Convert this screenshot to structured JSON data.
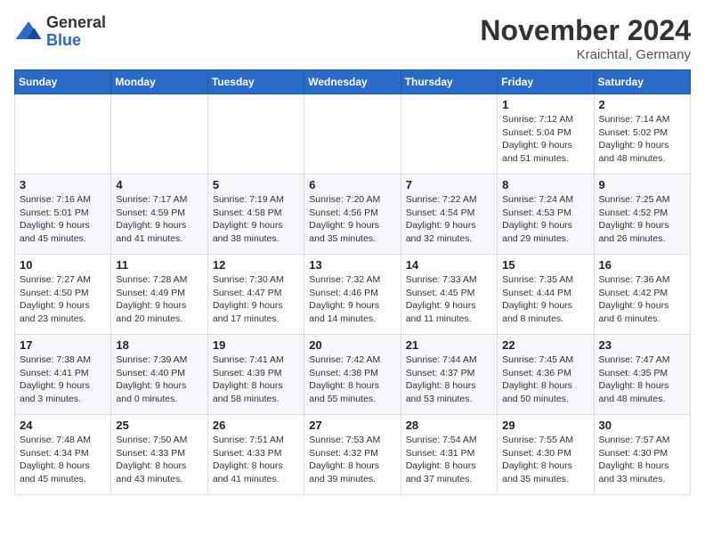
{
  "logo": {
    "general": "General",
    "blue": "Blue"
  },
  "title": "November 2024",
  "location": "Kraichtal, Germany",
  "days_of_week": [
    "Sunday",
    "Monday",
    "Tuesday",
    "Wednesday",
    "Thursday",
    "Friday",
    "Saturday"
  ],
  "weeks": [
    [
      {
        "day": "",
        "info": ""
      },
      {
        "day": "",
        "info": ""
      },
      {
        "day": "",
        "info": ""
      },
      {
        "day": "",
        "info": ""
      },
      {
        "day": "",
        "info": ""
      },
      {
        "day": "1",
        "info": "Sunrise: 7:12 AM\nSunset: 5:04 PM\nDaylight: 9 hours and 51 minutes."
      },
      {
        "day": "2",
        "info": "Sunrise: 7:14 AM\nSunset: 5:02 PM\nDaylight: 9 hours and 48 minutes."
      }
    ],
    [
      {
        "day": "3",
        "info": "Sunrise: 7:16 AM\nSunset: 5:01 PM\nDaylight: 9 hours and 45 minutes."
      },
      {
        "day": "4",
        "info": "Sunrise: 7:17 AM\nSunset: 4:59 PM\nDaylight: 9 hours and 41 minutes."
      },
      {
        "day": "5",
        "info": "Sunrise: 7:19 AM\nSunset: 4:58 PM\nDaylight: 9 hours and 38 minutes."
      },
      {
        "day": "6",
        "info": "Sunrise: 7:20 AM\nSunset: 4:56 PM\nDaylight: 9 hours and 35 minutes."
      },
      {
        "day": "7",
        "info": "Sunrise: 7:22 AM\nSunset: 4:54 PM\nDaylight: 9 hours and 32 minutes."
      },
      {
        "day": "8",
        "info": "Sunrise: 7:24 AM\nSunset: 4:53 PM\nDaylight: 9 hours and 29 minutes."
      },
      {
        "day": "9",
        "info": "Sunrise: 7:25 AM\nSunset: 4:52 PM\nDaylight: 9 hours and 26 minutes."
      }
    ],
    [
      {
        "day": "10",
        "info": "Sunrise: 7:27 AM\nSunset: 4:50 PM\nDaylight: 9 hours and 23 minutes."
      },
      {
        "day": "11",
        "info": "Sunrise: 7:28 AM\nSunset: 4:49 PM\nDaylight: 9 hours and 20 minutes."
      },
      {
        "day": "12",
        "info": "Sunrise: 7:30 AM\nSunset: 4:47 PM\nDaylight: 9 hours and 17 minutes."
      },
      {
        "day": "13",
        "info": "Sunrise: 7:32 AM\nSunset: 4:46 PM\nDaylight: 9 hours and 14 minutes."
      },
      {
        "day": "14",
        "info": "Sunrise: 7:33 AM\nSunset: 4:45 PM\nDaylight: 9 hours and 11 minutes."
      },
      {
        "day": "15",
        "info": "Sunrise: 7:35 AM\nSunset: 4:44 PM\nDaylight: 9 hours and 8 minutes."
      },
      {
        "day": "16",
        "info": "Sunrise: 7:36 AM\nSunset: 4:42 PM\nDaylight: 9 hours and 6 minutes."
      }
    ],
    [
      {
        "day": "17",
        "info": "Sunrise: 7:38 AM\nSunset: 4:41 PM\nDaylight: 9 hours and 3 minutes."
      },
      {
        "day": "18",
        "info": "Sunrise: 7:39 AM\nSunset: 4:40 PM\nDaylight: 9 hours and 0 minutes."
      },
      {
        "day": "19",
        "info": "Sunrise: 7:41 AM\nSunset: 4:39 PM\nDaylight: 8 hours and 58 minutes."
      },
      {
        "day": "20",
        "info": "Sunrise: 7:42 AM\nSunset: 4:38 PM\nDaylight: 8 hours and 55 minutes."
      },
      {
        "day": "21",
        "info": "Sunrise: 7:44 AM\nSunset: 4:37 PM\nDaylight: 8 hours and 53 minutes."
      },
      {
        "day": "22",
        "info": "Sunrise: 7:45 AM\nSunset: 4:36 PM\nDaylight: 8 hours and 50 minutes."
      },
      {
        "day": "23",
        "info": "Sunrise: 7:47 AM\nSunset: 4:35 PM\nDaylight: 8 hours and 48 minutes."
      }
    ],
    [
      {
        "day": "24",
        "info": "Sunrise: 7:48 AM\nSunset: 4:34 PM\nDaylight: 8 hours and 45 minutes."
      },
      {
        "day": "25",
        "info": "Sunrise: 7:50 AM\nSunset: 4:33 PM\nDaylight: 8 hours and 43 minutes."
      },
      {
        "day": "26",
        "info": "Sunrise: 7:51 AM\nSunset: 4:33 PM\nDaylight: 8 hours and 41 minutes."
      },
      {
        "day": "27",
        "info": "Sunrise: 7:53 AM\nSunset: 4:32 PM\nDaylight: 8 hours and 39 minutes."
      },
      {
        "day": "28",
        "info": "Sunrise: 7:54 AM\nSunset: 4:31 PM\nDaylight: 8 hours and 37 minutes."
      },
      {
        "day": "29",
        "info": "Sunrise: 7:55 AM\nSunset: 4:30 PM\nDaylight: 8 hours and 35 minutes."
      },
      {
        "day": "30",
        "info": "Sunrise: 7:57 AM\nSunset: 4:30 PM\nDaylight: 8 hours and 33 minutes."
      }
    ]
  ]
}
